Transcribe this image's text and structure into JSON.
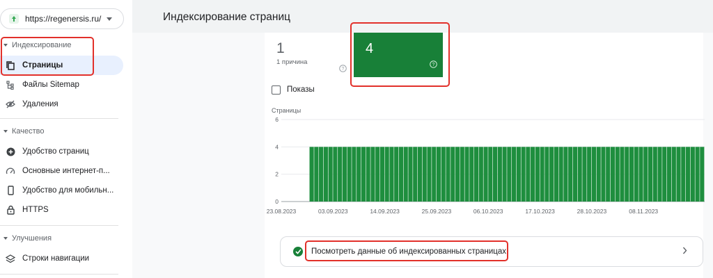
{
  "property": {
    "url": "https://regenersis.ru/"
  },
  "header": {
    "title": "Индексирование страниц"
  },
  "sidebar": {
    "sections": [
      {
        "title": "Индексирование",
        "items": [
          "Страницы",
          "Файлы Sitemap",
          "Удаления"
        ]
      },
      {
        "title": "Качество",
        "items": [
          "Удобство страниц",
          "Основные интернет-п...",
          "Удобство для мобильн...",
          "HTTPS"
        ]
      },
      {
        "title": "Улучшения",
        "items": [
          "Строки навигации"
        ]
      }
    ]
  },
  "summary": {
    "reasons_count": "1",
    "reasons_label": "1 причина",
    "indexed_count": "4",
    "show_label": "Показы"
  },
  "chart_data": {
    "type": "bar",
    "ylabel": "Страницы",
    "ylim": [
      0,
      6
    ],
    "yticks": [
      0,
      2,
      4,
      6
    ],
    "xticks": [
      "23.08.2023",
      "03.09.2023",
      "14.09.2023",
      "25.09.2023",
      "06.10.2023",
      "17.10.2023",
      "28.10.2023",
      "08.11.2023"
    ],
    "color": "#1e8e3e",
    "start_date": "2023-08-23",
    "values": [
      0,
      0,
      0,
      0,
      0,
      0,
      4,
      4,
      4,
      4,
      4,
      4,
      4,
      4,
      4,
      4,
      4,
      4,
      4,
      4,
      4,
      4,
      4,
      4,
      4,
      4,
      4,
      4,
      4,
      4,
      4,
      4,
      4,
      4,
      4,
      4,
      4,
      4,
      4,
      4,
      4,
      4,
      4,
      4,
      4,
      4,
      4,
      4,
      4,
      4,
      4,
      4,
      4,
      4,
      4,
      4,
      4,
      4,
      4,
      4,
      4,
      4,
      4,
      4,
      4,
      4,
      4,
      4,
      4,
      4,
      4,
      4,
      4,
      4,
      4,
      4,
      4,
      4,
      4,
      4,
      4,
      4,
      4,
      4,
      4,
      4,
      4,
      4,
      4,
      4
    ]
  },
  "footer_link": {
    "label": "Посмотреть данные об индексированных страницах"
  },
  "colors": {
    "accent_green": "#188038",
    "highlight": "#e2302a",
    "active_bg": "#e8f0fe"
  }
}
